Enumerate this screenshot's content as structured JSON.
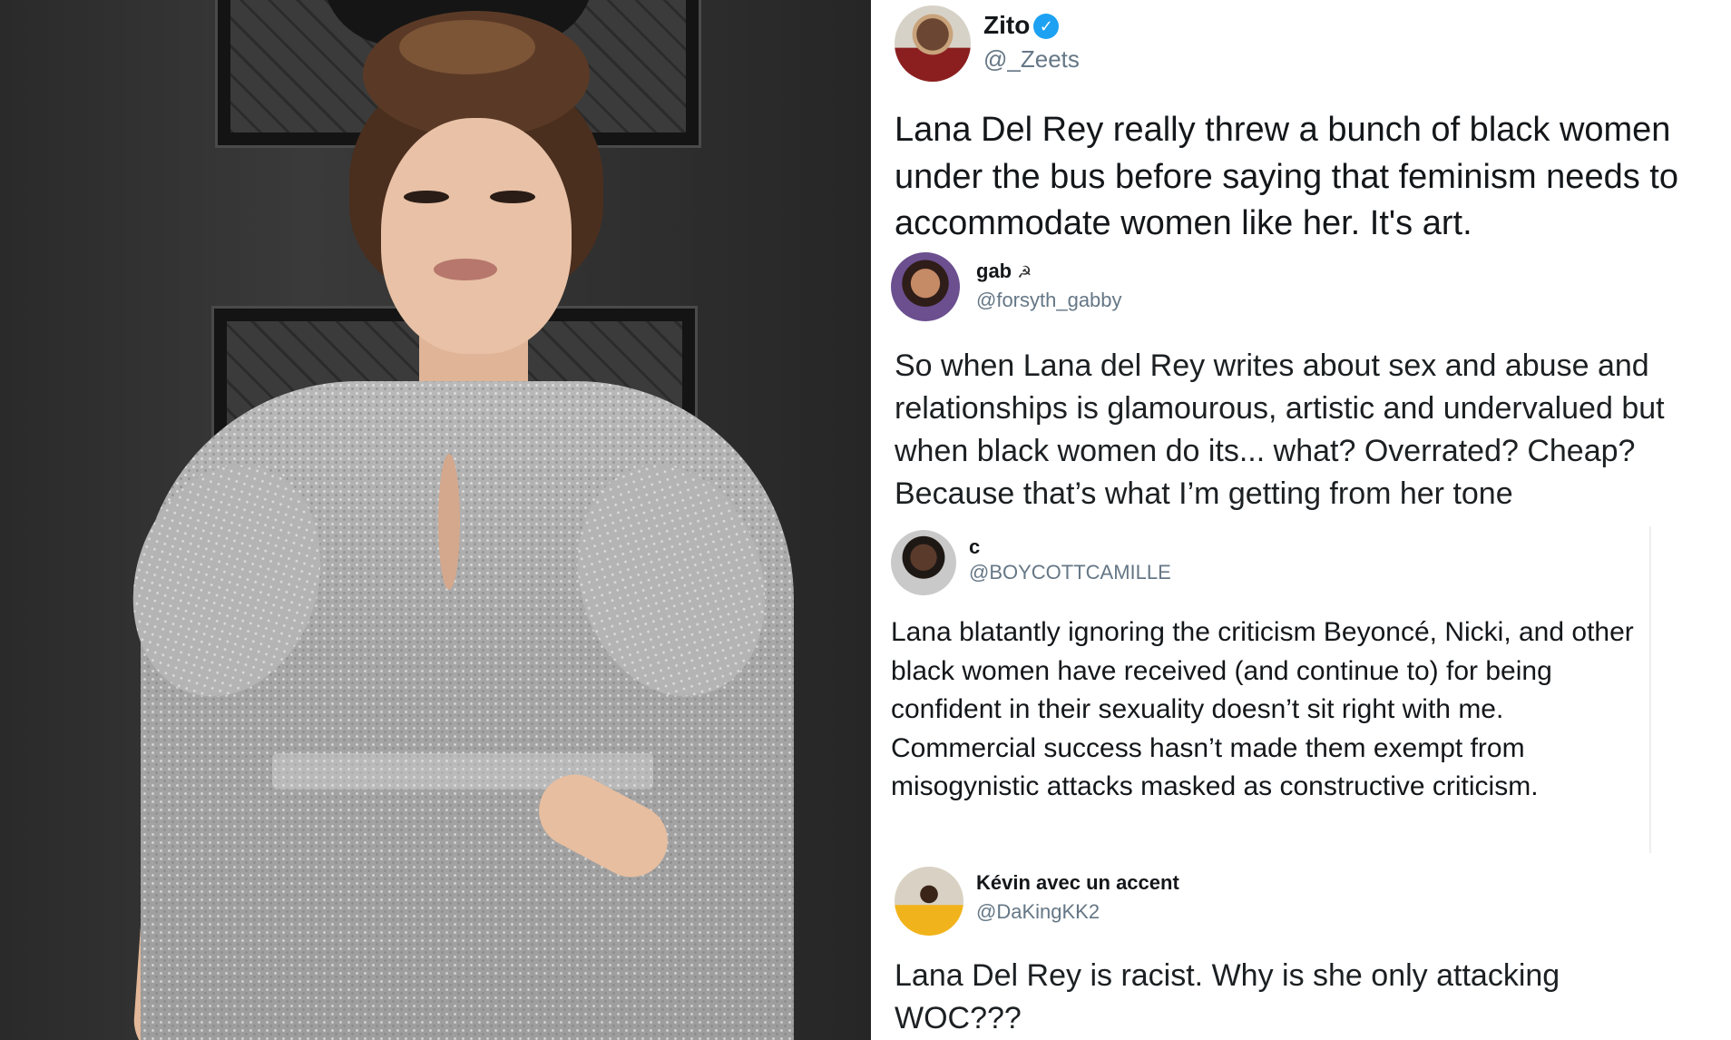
{
  "photo": {
    "subject_description": "woman in sequined silver dress on red carpet"
  },
  "tweets": [
    {
      "name": "Zito",
      "handle": "@_Zeets",
      "verified": true,
      "text": "Lana Del Rey really threw a bunch of black women under the bus before saying that feminism needs to accommodate women like her. It's art."
    },
    {
      "name": "gab",
      "name_emoji": "☭",
      "handle": "@forsyth_gabby",
      "text": "So when Lana del Rey writes about sex and abuse and relationships is glamourous, artistic and undervalued but when black women do its... what? Overrated? Cheap? Because that’s what I’m getting from her tone"
    },
    {
      "name": "c",
      "handle": "@BOYCOTTCAMILLE",
      "text": "Lana blatantly ignoring the criticism Beyoncé, Nicki, and other black women have received (and continue to) for being confident in their sexuality doesn’t sit right with me. Commercial success hasn’t made them exempt from misogynistic attacks masked as constructive criticism."
    },
    {
      "name": "Kévin avec un accent",
      "handle": "@DaKingKK2",
      "text": "Lana Del Rey is racist. Why is she only attacking WOC???"
    }
  ],
  "colors": {
    "verified_badge": "#1da1f2",
    "handle_gray": "#657786",
    "text_dark": "#14171a"
  },
  "icons": {
    "verified": "check-badge",
    "menu": "chevron-down"
  }
}
